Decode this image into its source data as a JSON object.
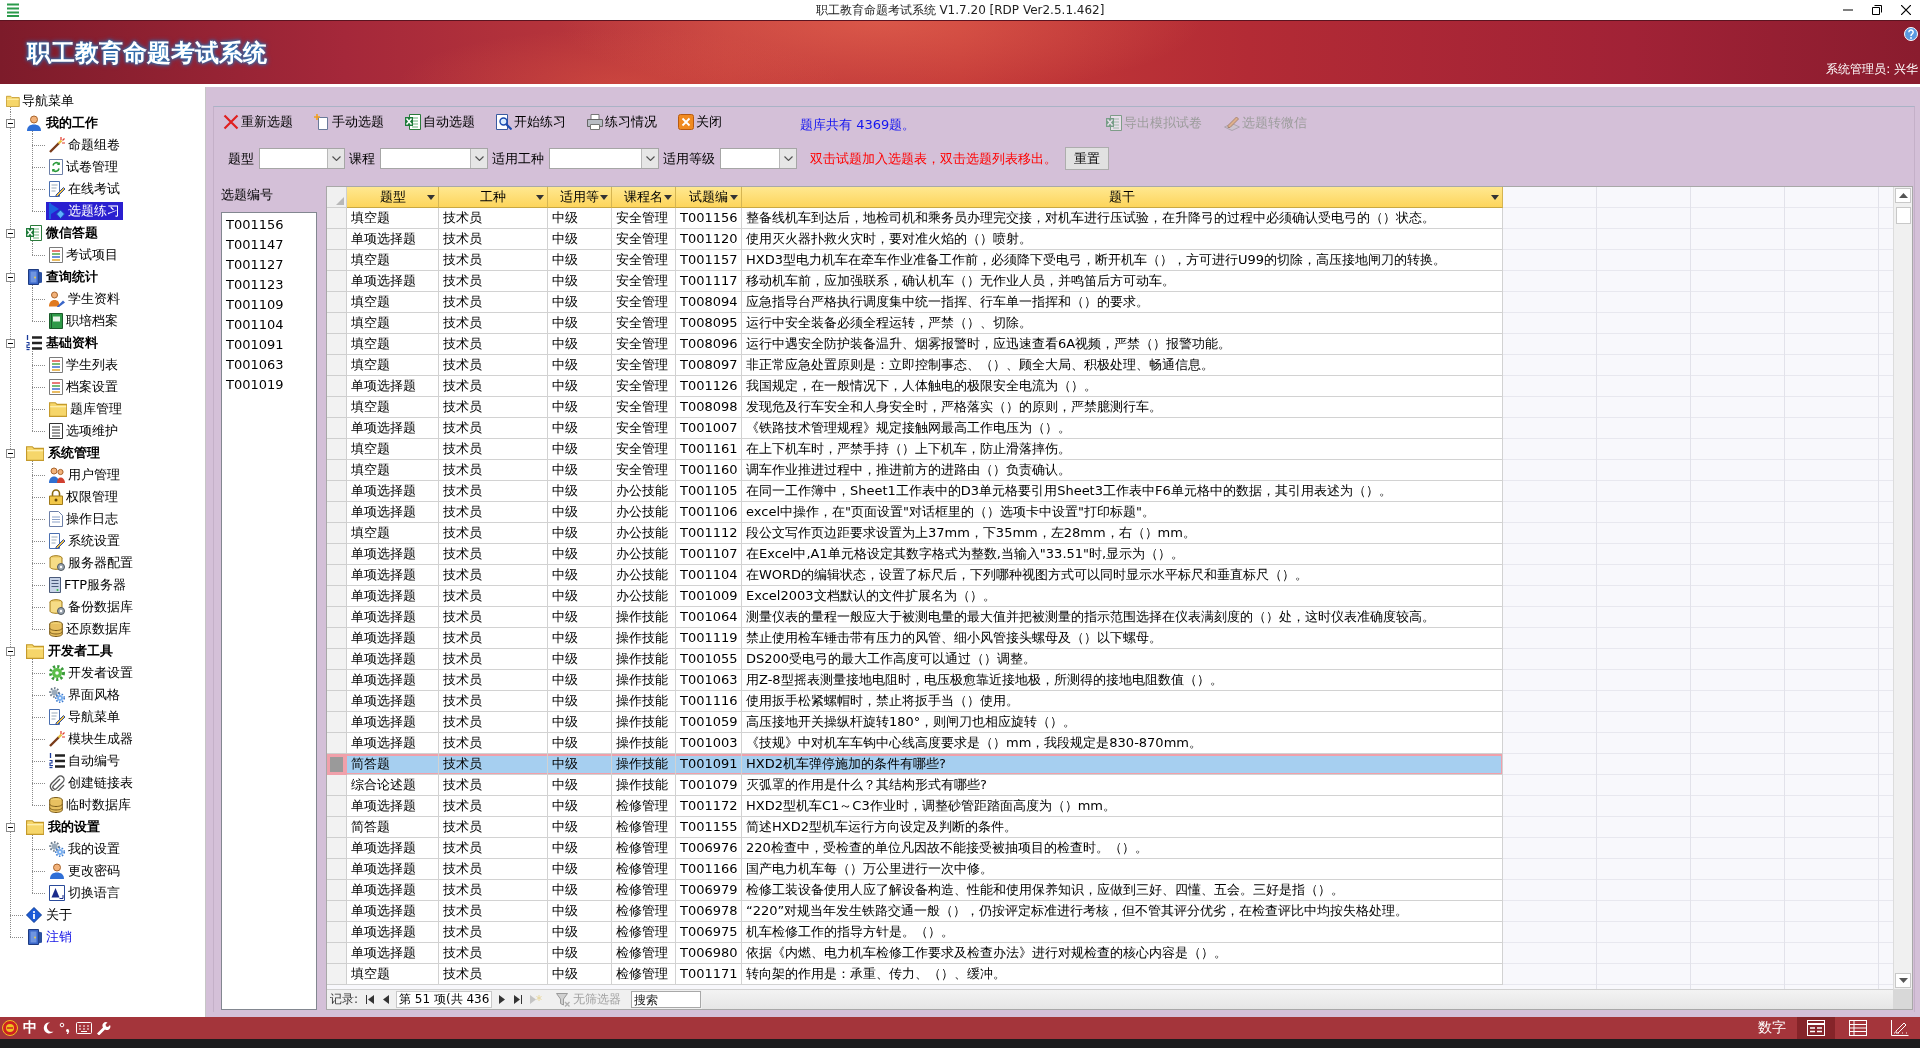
{
  "window": {
    "title": "职工教育命题考试系统 V1.7.20 [RDP Ver2.5.1.462]"
  },
  "banner": {
    "title": "职工教育命题考试系统",
    "user": "系统管理员: 兴华"
  },
  "sidebar": {
    "root": {
      "label": "导航菜单",
      "selected": false
    },
    "items": [
      {
        "label": "我的工作",
        "kind": "group",
        "expanded": true,
        "selected": false,
        "children": [
          {
            "label": "命题组卷",
            "selected": false
          },
          {
            "label": "试卷管理",
            "selected": false
          },
          {
            "label": "在线考试",
            "selected": false
          },
          {
            "label": "选题练习",
            "selected": true
          }
        ]
      },
      {
        "label": "微信答题",
        "kind": "group",
        "expanded": true,
        "selected": false,
        "children": [
          {
            "label": "考试项目",
            "selected": false
          }
        ]
      },
      {
        "label": "查询统计",
        "kind": "group",
        "expanded": true,
        "selected": false,
        "children": [
          {
            "label": "学生资料",
            "selected": false
          },
          {
            "label": "职培档案",
            "selected": false
          }
        ]
      },
      {
        "label": "基础资料",
        "kind": "group",
        "expanded": true,
        "selected": false,
        "children": [
          {
            "label": "学生列表",
            "selected": false
          },
          {
            "label": "档案设置",
            "selected": false
          },
          {
            "label": "题库管理",
            "selected": false
          },
          {
            "label": "选项维护",
            "selected": false
          }
        ]
      },
      {
        "label": "系统管理",
        "kind": "group",
        "expanded": true,
        "selected": false,
        "children": [
          {
            "label": "用户管理",
            "selected": false
          },
          {
            "label": "权限管理",
            "selected": false
          },
          {
            "label": "操作日志",
            "selected": false
          },
          {
            "label": "系统设置",
            "selected": false
          },
          {
            "label": "服务器配置",
            "selected": false
          },
          {
            "label": "FTP服务器",
            "selected": false
          },
          {
            "label": "备份数据库",
            "selected": false
          },
          {
            "label": "还原数据库",
            "selected": false
          }
        ]
      },
      {
        "label": "开发者工具",
        "kind": "group",
        "expanded": true,
        "selected": false,
        "children": [
          {
            "label": "开发者设置",
            "selected": false
          },
          {
            "label": "界面风格",
            "selected": false
          },
          {
            "label": "导航菜单",
            "selected": false
          },
          {
            "label": "模块生成器",
            "selected": false
          },
          {
            "label": "自动编号",
            "selected": false
          },
          {
            "label": "创建链接表",
            "selected": false
          },
          {
            "label": "临时数据库",
            "selected": false
          }
        ]
      },
      {
        "label": "我的设置",
        "kind": "group",
        "expanded": true,
        "selected": false,
        "children": [
          {
            "label": "我的设置",
            "selected": false
          },
          {
            "label": "更改密码",
            "selected": false
          },
          {
            "label": "切换语言",
            "selected": false
          }
        ]
      },
      {
        "label": "关于",
        "kind": "item",
        "selected": false
      },
      {
        "label": "注销",
        "kind": "link",
        "selected": false
      }
    ]
  },
  "toolbar": {
    "buttons": [
      {
        "label": "重新选题",
        "disabled": false
      },
      {
        "label": "手动选题",
        "disabled": false
      },
      {
        "label": "自动选题",
        "disabled": false
      },
      {
        "label": "开始练习",
        "disabled": false
      },
      {
        "label": "练习情况",
        "disabled": false
      },
      {
        "label": "关闭",
        "disabled": false
      }
    ],
    "summary": "题库共有 4369题。",
    "export_buttons": [
      {
        "label": "导出模拟试卷",
        "disabled": true
      },
      {
        "label": "选题转微信",
        "disabled": true
      }
    ]
  },
  "filters": {
    "fields": [
      {
        "label": "题型"
      },
      {
        "label": "课程"
      },
      {
        "label": "适用工种"
      },
      {
        "label": "适用等级"
      }
    ],
    "hint": "双击试题加入选题表，双击选题列表移出。",
    "reset_button": "重置"
  },
  "selected_questions": {
    "title": "选题编号",
    "items": [
      {
        "label": "T001156",
        "selected": false
      },
      {
        "label": "T001147",
        "selected": false
      },
      {
        "label": "T001127",
        "selected": false
      },
      {
        "label": "T001123",
        "selected": false
      },
      {
        "label": "T001109",
        "selected": false
      },
      {
        "label": "T001104",
        "selected": false
      },
      {
        "label": "T001091",
        "selected": false
      },
      {
        "label": "T001063",
        "selected": false
      },
      {
        "label": "T001019",
        "selected": false
      }
    ]
  },
  "table": {
    "columns": [
      "题型",
      "工种",
      "适用等",
      "课程名",
      "试题编",
      "题干"
    ],
    "rows": [
      {
        "cells": [
          "填空题",
          "技术员",
          "中级",
          "安全管理",
          "T001156",
          "整备线机车到达后，地检司机和乘务员办理完交接，对机车进行压试验，在升降弓的过程中必须确认受电弓的（）状态。"
        ],
        "selected": false
      },
      {
        "cells": [
          "单项选择题",
          "技术员",
          "中级",
          "安全管理",
          "T001120",
          "使用灭火器扑救火灾时，要对准火焰的（）喷射。"
        ],
        "selected": false
      },
      {
        "cells": [
          "填空题",
          "技术员",
          "中级",
          "安全管理",
          "T001157",
          "HXD3型电力机车在牵车作业准备工作前，必须降下受电弓，断开机车（），方可进行U99的切除，高压接地闸刀的转换。"
        ],
        "selected": false
      },
      {
        "cells": [
          "单项选择题",
          "技术员",
          "中级",
          "安全管理",
          "T001117",
          "移动机车前，应加强联系，确认机车（）无作业人员，并鸣笛后方可动车。"
        ],
        "selected": false
      },
      {
        "cells": [
          "填空题",
          "技术员",
          "中级",
          "安全管理",
          "T008094",
          "应急指导台严格执行调度集中统一指挥、行车单一指挥和（）的要求。"
        ],
        "selected": false
      },
      {
        "cells": [
          "填空题",
          "技术员",
          "中级",
          "安全管理",
          "T008095",
          "运行中安全装备必须全程运转，严禁（）、切除。"
        ],
        "selected": false
      },
      {
        "cells": [
          "填空题",
          "技术员",
          "中级",
          "安全管理",
          "T008096",
          "运行中遇安全防护装备温升、烟雾报警时，应迅速查看6A视频，严禁（）报警功能。"
        ],
        "selected": false
      },
      {
        "cells": [
          "填空题",
          "技术员",
          "中级",
          "安全管理",
          "T008097",
          "非正常应急处置原则是：立即控制事态、（）、顾全大局、积极处理、畅通信息。"
        ],
        "selected": false
      },
      {
        "cells": [
          "单项选择题",
          "技术员",
          "中级",
          "安全管理",
          "T001126",
          "我国规定，在一般情况下，人体触电的极限安全电流为（）。"
        ],
        "selected": false
      },
      {
        "cells": [
          "填空题",
          "技术员",
          "中级",
          "安全管理",
          "T008098",
          "发现危及行车安全和人身安全时，严格落实（）的原则，严禁臆测行车。"
        ],
        "selected": false
      },
      {
        "cells": [
          "单项选择题",
          "技术员",
          "中级",
          "安全管理",
          "T001007",
          "《铁路技术管理规程》规定接触网最高工作电压为（）。"
        ],
        "selected": false
      },
      {
        "cells": [
          "填空题",
          "技术员",
          "中级",
          "安全管理",
          "T001161",
          "在上下机车时，严禁手持（）上下机车，防止滑落摔伤。"
        ],
        "selected": false
      },
      {
        "cells": [
          "填空题",
          "技术员",
          "中级",
          "安全管理",
          "T001160",
          "调车作业推进过程中，推进前方的进路由（）负责确认。"
        ],
        "selected": false
      },
      {
        "cells": [
          "单项选择题",
          "技术员",
          "中级",
          "办公技能",
          "T001105",
          "在同一工作簿中，Sheet1工作表中的D3单元格要引用Sheet3工作表中F6单元格中的数据，其引用表述为（）。"
        ],
        "selected": false
      },
      {
        "cells": [
          "单项选择题",
          "技术员",
          "中级",
          "办公技能",
          "T001106",
          "excel中操作，在\"页面设置\"对话框里的（）选项卡中设置\"打印标题\"。"
        ],
        "selected": false
      },
      {
        "cells": [
          "填空题",
          "技术员",
          "中级",
          "办公技能",
          "T001112",
          "段公文写作页边距要求设置为上37mm，下35mm，左28mm，右（）mm。"
        ],
        "selected": false
      },
      {
        "cells": [
          "单项选择题",
          "技术员",
          "中级",
          "办公技能",
          "T001107",
          "在Excel中,A1单元格设定其数字格式为整数,当输入\"33.51\"时,显示为（）。"
        ],
        "selected": false
      },
      {
        "cells": [
          "单项选择题",
          "技术员",
          "中级",
          "办公技能",
          "T001104",
          "在WORD的编辑状态，设置了标尺后，下列哪种视图方式可以同时显示水平标尺和垂直标尺（）。"
        ],
        "selected": false
      },
      {
        "cells": [
          "单项选择题",
          "技术员",
          "中级",
          "办公技能",
          "T001009",
          "Excel2003文档默认的文件扩展名为（）。"
        ],
        "selected": false
      },
      {
        "cells": [
          "单项选择题",
          "技术员",
          "中级",
          "操作技能",
          "T001064",
          "测量仪表的量程一般应大于被测电量的最大值并把被测量的指示范围选择在仪表满刻度的（）处，这时仪表准确度较高。"
        ],
        "selected": false
      },
      {
        "cells": [
          "单项选择题",
          "技术员",
          "中级",
          "操作技能",
          "T001119",
          "禁止使用检车锤击带有压力的风管、细小风管接头螺母及（）以下螺母。"
        ],
        "selected": false
      },
      {
        "cells": [
          "单项选择题",
          "技术员",
          "中级",
          "操作技能",
          "T001055",
          "DS200受电弓的最大工作高度可以通过（）调整。"
        ],
        "selected": false
      },
      {
        "cells": [
          "单项选择题",
          "技术员",
          "中级",
          "操作技能",
          "T001063",
          "用Z-8型摇表测量接地电阻时，电压极愈靠近接地极，所测得的接地电阻数值（）。"
        ],
        "selected": false
      },
      {
        "cells": [
          "单项选择题",
          "技术员",
          "中级",
          "操作技能",
          "T001116",
          "使用扳手松紧螺帽时，禁止将扳手当（）使用。"
        ],
        "selected": false
      },
      {
        "cells": [
          "单项选择题",
          "技术员",
          "中级",
          "操作技能",
          "T001059",
          "高压接地开关操纵杆旋转180°，则闸刀也相应旋转（）。"
        ],
        "selected": false
      },
      {
        "cells": [
          "单项选择题",
          "技术员",
          "中级",
          "操作技能",
          "T001003",
          "《技规》中对机车车钩中心线高度要求是（）mm，我段规定是830-870mm。"
        ],
        "selected": false
      },
      {
        "cells": [
          "简答题",
          "技术员",
          "中级",
          "操作技能",
          "T001091",
          "HXD2机车弹停施加的条件有哪些?"
        ],
        "selected": true
      },
      {
        "cells": [
          "综合论述题",
          "技术员",
          "中级",
          "操作技能",
          "T001079",
          "灭弧罩的作用是什么？其结构形式有哪些?"
        ],
        "selected": false
      },
      {
        "cells": [
          "单项选择题",
          "技术员",
          "中级",
          "检修管理",
          "T001172",
          "HXD2型机车C1～C3作业时，调整砂管距踏面高度为（）mm。"
        ],
        "selected": false
      },
      {
        "cells": [
          "简答题",
          "技术员",
          "中级",
          "检修管理",
          "T001155",
          "简述HXD2型机车运行方向设定及判断的条件。"
        ],
        "selected": false
      },
      {
        "cells": [
          "单项选择题",
          "技术员",
          "中级",
          "检修管理",
          "T006976",
          "220检查中，受检查的单位凡因故不能接受被抽项目的检查时。（）。"
        ],
        "selected": false
      },
      {
        "cells": [
          "单项选择题",
          "技术员",
          "中级",
          "检修管理",
          "T001166",
          "国产电力机车每（）万公里进行一次中修。"
        ],
        "selected": false
      },
      {
        "cells": [
          "单项选择题",
          "技术员",
          "中级",
          "检修管理",
          "T006979",
          "检修工装设备使用人应了解设备构造、性能和使用保养知识，应做到三好、四懂、五会。三好是指（）。"
        ],
        "selected": false
      },
      {
        "cells": [
          "单项选择题",
          "技术员",
          "中级",
          "检修管理",
          "T006978",
          "“220”对规当年发生铁路交通一般（），仍按评定标准进行考核，但不管其评分优劣，在检查评比中均按失格处理。"
        ],
        "selected": false
      },
      {
        "cells": [
          "单项选择题",
          "技术员",
          "中级",
          "检修管理",
          "T006975",
          "机车检修工作的指导方针是。（）。"
        ],
        "selected": false
      },
      {
        "cells": [
          "单项选择题",
          "技术员",
          "中级",
          "检修管理",
          "T006980",
          "依据《内燃、电力机车检修工作要求及检查办法》进行对规检查的核心内容是（）。"
        ],
        "selected": false
      },
      {
        "cells": [
          "填空题",
          "技术员",
          "中级",
          "检修管理",
          "T001171",
          "转向架的作用是：承重、传力、（）、缓冲。"
        ],
        "selected": false
      }
    ]
  },
  "record_nav": {
    "label": "记录:",
    "buttons_before": [
      {
        "kind": "first",
        "disabled": false
      },
      {
        "kind": "prev",
        "disabled": false
      }
    ],
    "position": "第 51 项(共 436",
    "buttons_after": [
      {
        "kind": "next",
        "disabled": false
      },
      {
        "kind": "last",
        "disabled": false
      },
      {
        "kind": "new",
        "disabled": true
      }
    ],
    "filter": {
      "label": "无筛选器",
      "active": false
    },
    "search": {
      "placeholder": "搜索"
    }
  },
  "status_bar": {
    "ime_label": "中",
    "mode": "数字",
    "views": [
      {
        "selected": true
      },
      {
        "selected": false
      },
      {
        "selected": false
      }
    ]
  }
}
